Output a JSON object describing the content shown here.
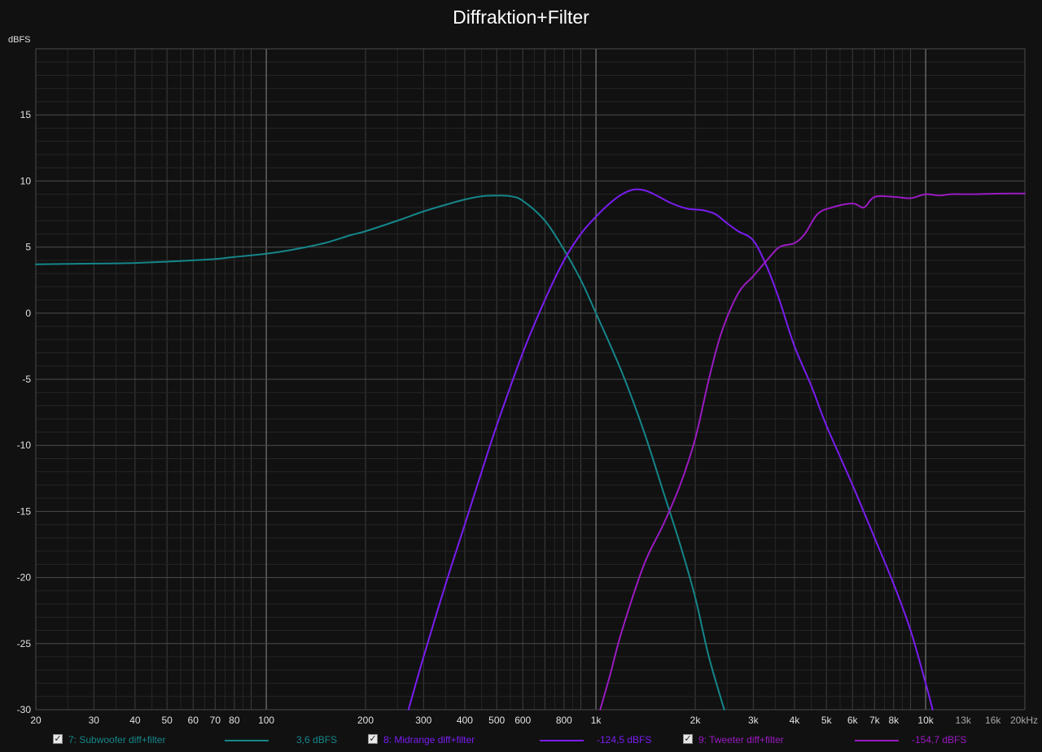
{
  "chart_data": {
    "type": "line",
    "title": "Diffraktion+Filter",
    "ylabel": "dBFS",
    "xlabel": "",
    "x_scale": "log",
    "xlim": [
      20,
      20000
    ],
    "ylim": [
      -30,
      20
    ],
    "grid": true,
    "x_tick_labels": [
      {
        "v": 20,
        "t": "20"
      },
      {
        "v": 30,
        "t": "30"
      },
      {
        "v": 40,
        "t": "40"
      },
      {
        "v": 50,
        "t": "50"
      },
      {
        "v": 60,
        "t": "60"
      },
      {
        "v": 70,
        "t": "70"
      },
      {
        "v": 80,
        "t": "80"
      },
      {
        "v": 100,
        "t": "100"
      },
      {
        "v": 200,
        "t": "200"
      },
      {
        "v": 300,
        "t": "300"
      },
      {
        "v": 400,
        "t": "400"
      },
      {
        "v": 500,
        "t": "500"
      },
      {
        "v": 600,
        "t": "600"
      },
      {
        "v": 800,
        "t": "800"
      },
      {
        "v": 1000,
        "t": "1k"
      },
      {
        "v": 2000,
        "t": "2k"
      },
      {
        "v": 3000,
        "t": "3k"
      },
      {
        "v": 4000,
        "t": "4k"
      },
      {
        "v": 5000,
        "t": "5k"
      },
      {
        "v": 6000,
        "t": "6k"
      },
      {
        "v": 7000,
        "t": "7k"
      },
      {
        "v": 8000,
        "t": "8k"
      },
      {
        "v": 10000,
        "t": "10k"
      },
      {
        "v": 13000,
        "t": "13k"
      },
      {
        "v": 16000,
        "t": "16k"
      },
      {
        "v": 20000,
        "t": "20kHz"
      }
    ],
    "y_ticks": [
      {
        "v": 15,
        "t": "15"
      },
      {
        "v": 10,
        "t": "10"
      },
      {
        "v": 5,
        "t": "5"
      },
      {
        "v": 0,
        "t": "0"
      },
      {
        "v": -5,
        "t": "-5"
      },
      {
        "v": -10,
        "t": "-10"
      },
      {
        "v": -15,
        "t": "-15"
      },
      {
        "v": -20,
        "t": "-20"
      },
      {
        "v": -25,
        "t": "-25"
      },
      {
        "v": -30,
        "t": "-30"
      }
    ],
    "legend_position": "bottom",
    "series": [
      {
        "name": "7: Subwoofer diff+filter",
        "value_label": "3,6 dBFS",
        "color": "#15868a",
        "points": [
          [
            20,
            3.7
          ],
          [
            30,
            3.75
          ],
          [
            40,
            3.8
          ],
          [
            50,
            3.9
          ],
          [
            60,
            4.0
          ],
          [
            70,
            4.1
          ],
          [
            80,
            4.25
          ],
          [
            100,
            4.5
          ],
          [
            120,
            4.8
          ],
          [
            150,
            5.3
          ],
          [
            180,
            5.9
          ],
          [
            200,
            6.2
          ],
          [
            250,
            7.0
          ],
          [
            300,
            7.7
          ],
          [
            350,
            8.2
          ],
          [
            400,
            8.6
          ],
          [
            450,
            8.85
          ],
          [
            500,
            8.9
          ],
          [
            550,
            8.85
          ],
          [
            600,
            8.5
          ],
          [
            700,
            7.0
          ],
          [
            800,
            4.8
          ],
          [
            900,
            2.5
          ],
          [
            1000,
            0.0
          ],
          [
            1200,
            -4.5
          ],
          [
            1400,
            -9.0
          ],
          [
            1600,
            -13.5
          ],
          [
            1800,
            -17.5
          ],
          [
            2000,
            -21.5
          ],
          [
            2200,
            -26.0
          ],
          [
            2450,
            -30.0
          ]
        ]
      },
      {
        "name": "8: Midrange diff+filter",
        "value_label": "-124,5 dBFS",
        "color": "#7a1cf0",
        "points": [
          [
            270,
            -30.0
          ],
          [
            300,
            -26.0
          ],
          [
            350,
            -20.5
          ],
          [
            400,
            -16.0
          ],
          [
            450,
            -12.0
          ],
          [
            500,
            -8.5
          ],
          [
            600,
            -3.0
          ],
          [
            700,
            1.0
          ],
          [
            800,
            4.0
          ],
          [
            900,
            6.0
          ],
          [
            1000,
            7.3
          ],
          [
            1100,
            8.3
          ],
          [
            1200,
            9.0
          ],
          [
            1300,
            9.35
          ],
          [
            1400,
            9.3
          ],
          [
            1500,
            9.0
          ],
          [
            1700,
            8.3
          ],
          [
            1900,
            7.9
          ],
          [
            2100,
            7.8
          ],
          [
            2300,
            7.5
          ],
          [
            2500,
            6.8
          ],
          [
            2700,
            6.2
          ],
          [
            3000,
            5.5
          ],
          [
            3300,
            3.5
          ],
          [
            3600,
            1.0
          ],
          [
            4000,
            -2.5
          ],
          [
            4500,
            -5.5
          ],
          [
            5000,
            -8.5
          ],
          [
            6000,
            -13.0
          ],
          [
            7000,
            -17.0
          ],
          [
            8000,
            -20.5
          ],
          [
            9000,
            -24.0
          ],
          [
            10000,
            -28.0
          ],
          [
            10500,
            -30.0
          ]
        ]
      },
      {
        "name": "9: Tweeter diff+filter",
        "value_label": "-154,7 dBFS",
        "color": "#9a1ac2",
        "points": [
          [
            1030,
            -30.0
          ],
          [
            1100,
            -27.5
          ],
          [
            1200,
            -24.0
          ],
          [
            1400,
            -19.0
          ],
          [
            1600,
            -16.0
          ],
          [
            1800,
            -13.0
          ],
          [
            2000,
            -9.5
          ],
          [
            2200,
            -5.0
          ],
          [
            2400,
            -1.5
          ],
          [
            2700,
            1.5
          ],
          [
            3000,
            2.8
          ],
          [
            3300,
            4.0
          ],
          [
            3600,
            5.0
          ],
          [
            4000,
            5.3
          ],
          [
            4300,
            6.0
          ],
          [
            4700,
            7.5
          ],
          [
            5200,
            8.0
          ],
          [
            6000,
            8.3
          ],
          [
            6500,
            8.0
          ],
          [
            7000,
            8.8
          ],
          [
            8000,
            8.8
          ],
          [
            9000,
            8.7
          ],
          [
            10000,
            9.0
          ],
          [
            11000,
            8.9
          ],
          [
            12000,
            9.0
          ],
          [
            14000,
            9.0
          ],
          [
            17000,
            9.05
          ],
          [
            20000,
            9.05
          ]
        ]
      }
    ]
  }
}
